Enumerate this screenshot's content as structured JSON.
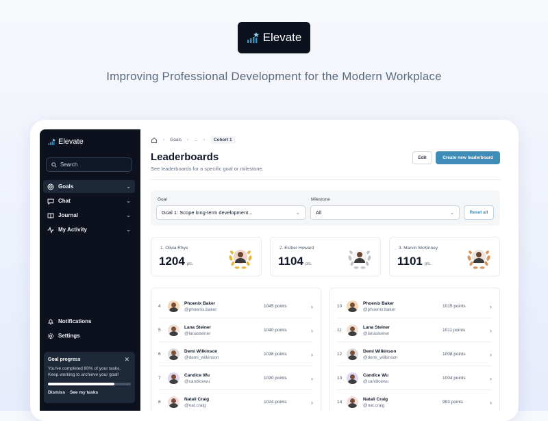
{
  "brand": {
    "name": "Elevate",
    "tagline": "Improving Professional Development for the Modern Workplace"
  },
  "sidebar": {
    "logo": "Elevate",
    "search_placeholder": "Search",
    "nav": [
      {
        "label": "Goals",
        "icon": "target-icon",
        "active": true
      },
      {
        "label": "Chat",
        "icon": "chat-icon",
        "active": false
      },
      {
        "label": "Journal",
        "icon": "book-icon",
        "active": false
      },
      {
        "label": "My Activity",
        "icon": "activity-icon",
        "active": false
      }
    ],
    "bottom": [
      {
        "label": "Notifications",
        "icon": "bell-icon"
      },
      {
        "label": "Settings",
        "icon": "gear-icon"
      }
    ],
    "goal_card": {
      "title": "Goal progress",
      "line1": "You've completed 80% of your tasks.",
      "line2": "Keep working to archieve your goal!",
      "progress": 0.8,
      "dismiss": "Dismiss",
      "see_tasks": "See my tasks"
    }
  },
  "breadcrumb": {
    "home_icon": "home-icon",
    "items": [
      "Goals",
      "...",
      "Cohort 1"
    ]
  },
  "header": {
    "title": "Leaderboards",
    "subtitle": "See leaderboards for a specific goal or milestone.",
    "edit": "Edit",
    "create": "Create new leaderboard"
  },
  "filters": {
    "goal_label": "Goal",
    "goal_value": "Goal 1: Scope long-term development...",
    "milestone_label": "Milestone",
    "milestone_value": "All",
    "reset": "Reset all"
  },
  "podium": [
    {
      "rank_name": "1. Olivia Rhye",
      "points": "1204",
      "unit": "pts.",
      "medal": "gold",
      "color": "#e8b73a"
    },
    {
      "rank_name": "2. Esther Howard",
      "points": "1104",
      "unit": "pts.",
      "medal": "silver",
      "color": "#c0c5cc"
    },
    {
      "rank_name": "3. Marvin McKinney",
      "points": "1101",
      "unit": "pts.",
      "medal": "bronze",
      "color": "#d9935b"
    }
  ],
  "list_left": [
    {
      "rank": "4",
      "name": "Phoenix Baker",
      "handle": "@phoenix.baker",
      "points": "1045 points"
    },
    {
      "rank": "5",
      "name": "Lana Steiner",
      "handle": "@lanasteiner",
      "points": "1040 points"
    },
    {
      "rank": "6",
      "name": "Demi Wilkinson",
      "handle": "@demi_wilkinson",
      "points": "1038 points"
    },
    {
      "rank": "7",
      "name": "Candice Wu",
      "handle": "@candicewu",
      "points": "1030 points"
    },
    {
      "rank": "8",
      "name": "Natali Craig",
      "handle": "@nat.craig",
      "points": "1024 points"
    }
  ],
  "list_right": [
    {
      "rank": "10",
      "name": "Phoenix Baker",
      "handle": "@phoenix.baker",
      "points": "1015 points"
    },
    {
      "rank": "11",
      "name": "Lana Steiner",
      "handle": "@lanasteiner",
      "points": "1011 points"
    },
    {
      "rank": "12",
      "name": "Demi Wilkinson",
      "handle": "@demi_wilkinson",
      "points": "1008 points"
    },
    {
      "rank": "13",
      "name": "Candice Wu",
      "handle": "@candicewu",
      "points": "1004 points"
    },
    {
      "rank": "14",
      "name": "Natali Craig",
      "handle": "@nat.craig",
      "points": "993 points"
    }
  ]
}
